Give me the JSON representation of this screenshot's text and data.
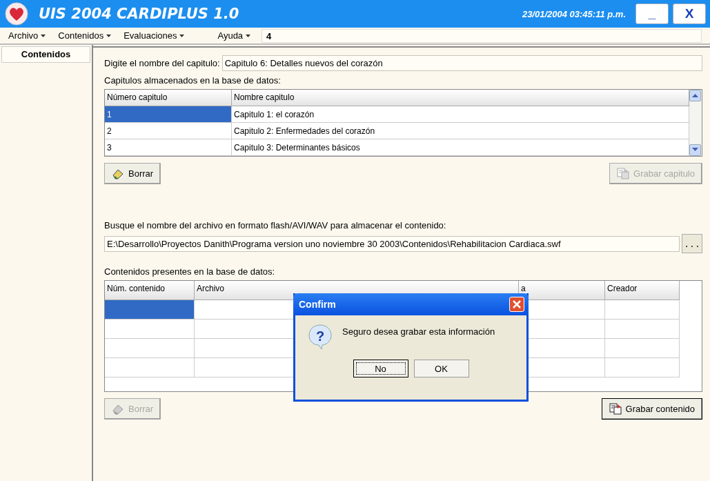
{
  "window": {
    "title": "UIS 2004 CARDIPLUS 1.0",
    "datetime": "23/01/2004 03:45:11 p.m.",
    "minimize": "_",
    "close": "X"
  },
  "menu": [
    {
      "label": "Archivo"
    },
    {
      "label": "Contenidos"
    },
    {
      "label": "Evaluaciones"
    },
    {
      "label": "Ayuda"
    }
  ],
  "menu_field": {
    "value": "4"
  },
  "sidebar": {
    "items": [
      {
        "label": "Contenidos",
        "selected": true
      }
    ]
  },
  "chapter_name": {
    "label": "Digite el nombre del capitulo:",
    "value": "Capitulo 6: Detalles nuevos del corazón"
  },
  "chapters": {
    "label": "Capitulos almacenados en la base de datos:",
    "columns": [
      "Número capitulo",
      "Nombre capitulo"
    ],
    "rows": [
      {
        "number": "1",
        "name": "Capitulo 1: el corazón",
        "selected": true
      },
      {
        "number": "2",
        "name": "Capitulo 2: Enfermedades del corazón",
        "selected": false
      },
      {
        "number": "3",
        "name": "Capitulo 3: Determinantes básicos",
        "selected": false
      }
    ]
  },
  "chapter_buttons": [
    {
      "label": "Borrar",
      "disabled": false
    },
    {
      "label": "Grabar capitulo",
      "disabled": true
    }
  ],
  "file": {
    "label": "Busque el nombre del archivo en formato flash/AVI/WAV para almacenar el contenido:",
    "value": "E:\\Desarrollo\\Proyectos Danith\\Programa version uno noviembre 30 2003\\Contenidos\\Rehabilitacion Cardiaca.swf",
    "browse": "..."
  },
  "contents": {
    "label": "Contenidos presentes en la base de datos:",
    "columns": [
      "Núm. contenido",
      "Archivo",
      "a",
      "Creador"
    ],
    "rows": [
      {
        "selected": true
      },
      {
        "selected": false
      },
      {
        "selected": false
      },
      {
        "selected": false
      }
    ]
  },
  "content_buttons": [
    {
      "label": "Borrar",
      "disabled": true
    },
    {
      "label": "Grabar contenido",
      "disabled": false
    }
  ],
  "dialog": {
    "title": "Confirm",
    "icon": "?",
    "message": "Seguro desea grabar esta información",
    "buttons": [
      {
        "label": "No",
        "focused": true
      },
      {
        "label": "OK",
        "focused": false
      }
    ]
  }
}
